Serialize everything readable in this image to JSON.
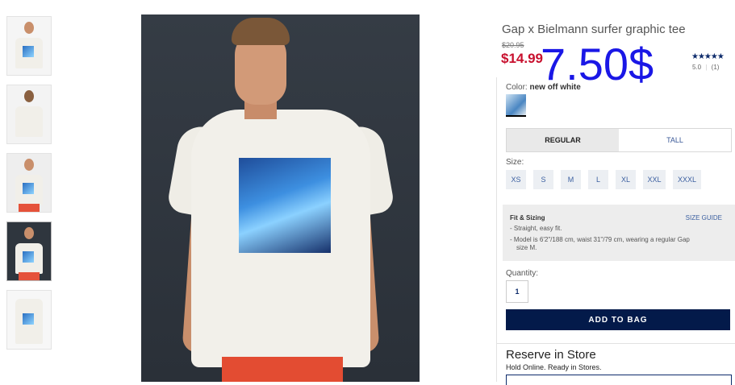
{
  "product": {
    "title": "Gap x Bielmann surfer graphic tee",
    "old_price": "$20.95",
    "price": "$14.99",
    "overlay_price": "7.50$",
    "stars": "★★★★★",
    "rating_score": "5.0",
    "rating_sep": "|",
    "rating_count": "(1)"
  },
  "color": {
    "label": "Color:",
    "value": "new off white"
  },
  "fit_tabs": [
    {
      "label": "REGULAR",
      "active": true
    },
    {
      "label": "TALL",
      "active": false
    }
  ],
  "size": {
    "label": "Size:",
    "options": [
      "XS",
      "S",
      "M",
      "L",
      "XL",
      "XXL",
      "XXXL"
    ]
  },
  "fit_info": {
    "title": "Fit & Sizing",
    "size_guide": "SIZE GUIDE",
    "line1": "- Straight, easy fit.",
    "line2": "- Model is 6'2\"/188 cm, waist 31\"/79 cm, wearing a regular Gap",
    "line3": "size M."
  },
  "quantity": {
    "label": "Quantity:",
    "value": "1"
  },
  "add_to_bag": "ADD TO BAG",
  "reserve": {
    "title": "Reserve in Store",
    "subtitle": "Hold Online. Ready in Stores."
  },
  "colors": {
    "price_red": "#c8102e",
    "overlay_blue": "#1a17e6",
    "navy": "#031a4a",
    "link_blue": "#3b5fa0"
  }
}
